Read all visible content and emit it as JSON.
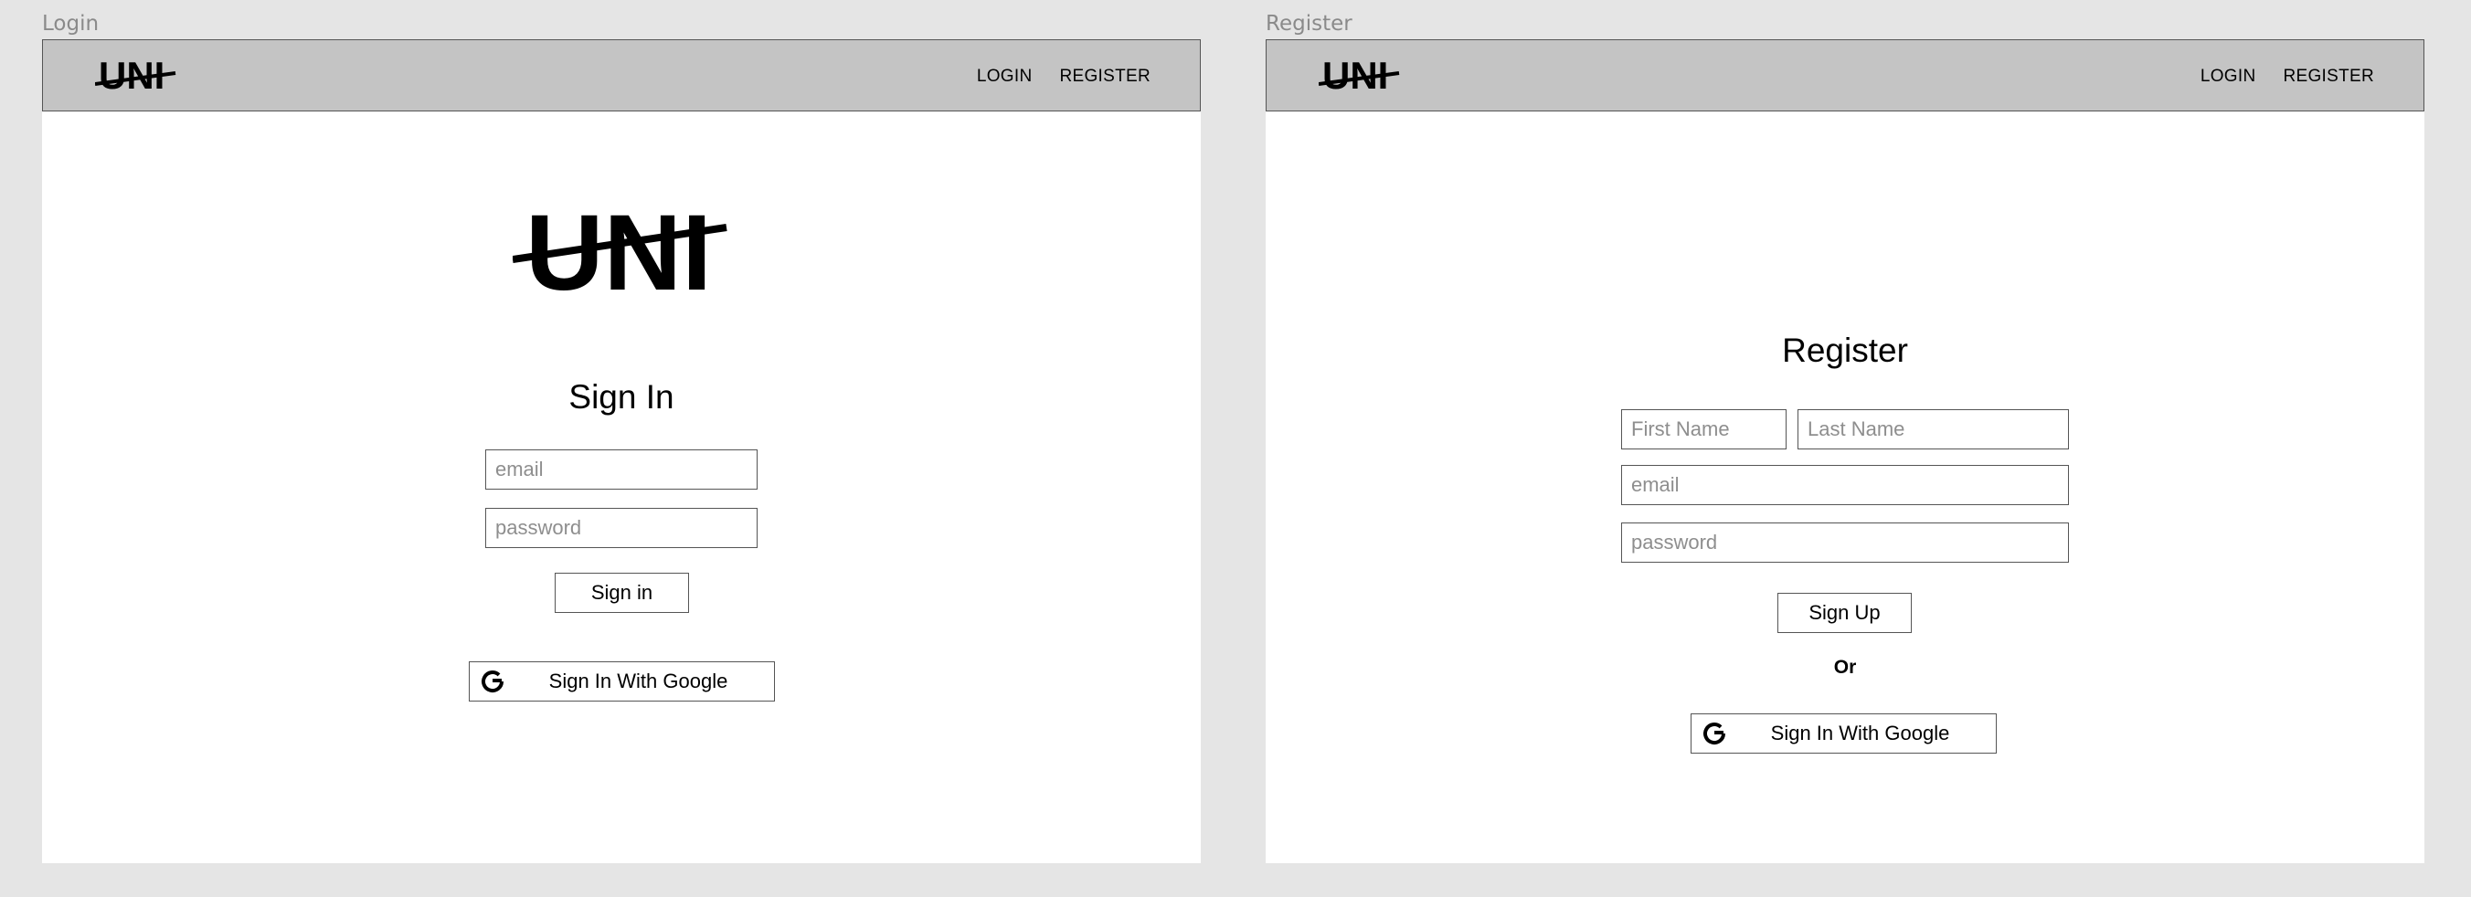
{
  "login": {
    "frame_label": "Login",
    "logo": "UNI",
    "nav": {
      "login": "LOGIN",
      "register": "REGISTER"
    },
    "title": "Sign In",
    "email_placeholder": "email",
    "password_placeholder": "password",
    "submit_label": "Sign in",
    "google_label": "Sign In With Google"
  },
  "register": {
    "frame_label": "Register",
    "logo": "UNI",
    "nav": {
      "login": "LOGIN",
      "register": "REGISTER"
    },
    "title": "Register",
    "first_name_placeholder": "First Name",
    "last_name_placeholder": "Last Name",
    "email_placeholder": "email",
    "password_placeholder": "password",
    "submit_label": "Sign Up",
    "or_label": "Or",
    "google_label": "Sign In With Google"
  },
  "colors": {
    "canvas": "#e5e5e5",
    "navbar": "#c4c4c4",
    "border": "#555555",
    "placeholder": "#8e8e8e"
  }
}
